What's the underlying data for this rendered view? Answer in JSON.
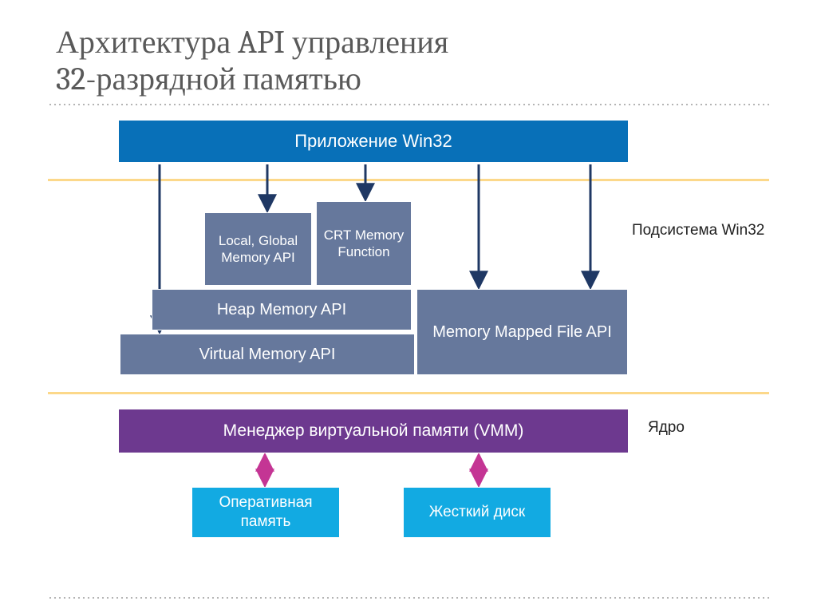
{
  "title_line1": "Архитектура API управления",
  "title_line2": "32-разрядной памятью",
  "diagram": {
    "app": "Приложение Win32",
    "subsystem_label": "Подсистема Win32",
    "local_global": "Local, Global Memory API",
    "crt": "CRT Memory Function",
    "heap": "Heap Memory API",
    "mmap": "Memory Mapped File API",
    "virtual": "Virtual Memory API",
    "vmm": "Менеджер виртуальной памяти (VMM)",
    "kernel_label": "Ядро",
    "ram": "Оперативная память",
    "hdd": "Жесткий диск"
  },
  "colors": {
    "app": "#0870b8",
    "api_block": "#66789c",
    "vmm": "#6d398f",
    "storage": "#12aae2",
    "divider": "#fcd88a",
    "arrow_navy": "#1f3864",
    "arrow_magenta": "#c43594"
  }
}
